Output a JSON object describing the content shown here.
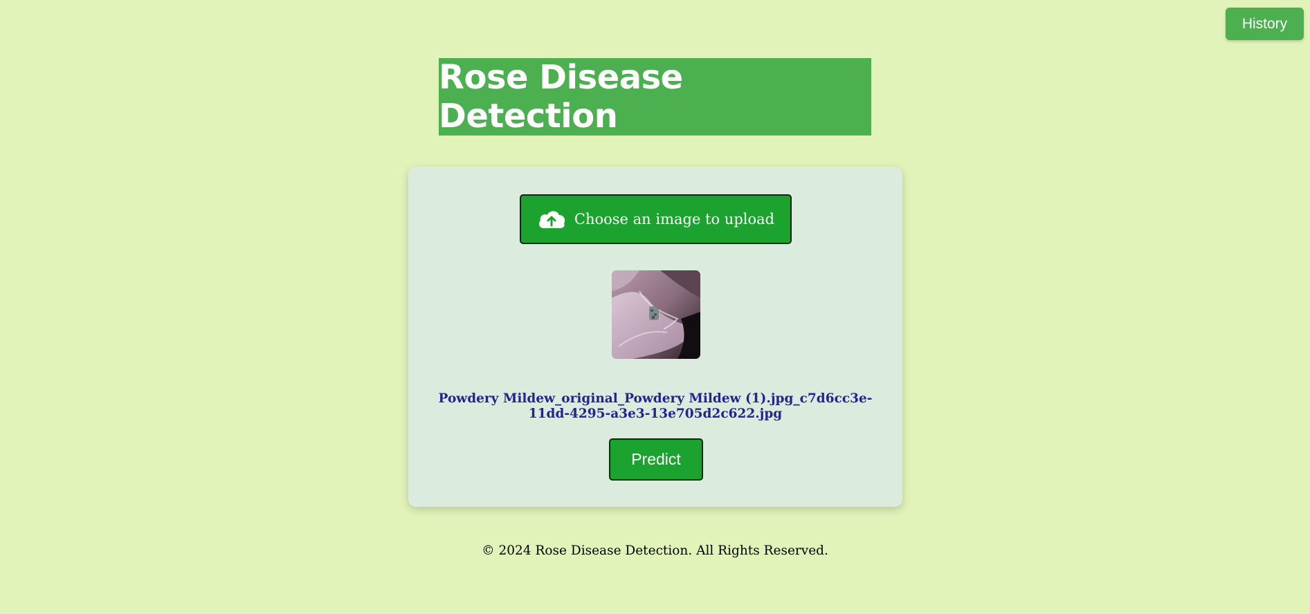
{
  "header": {
    "history_label": "History"
  },
  "banner": {
    "title": "Rose Disease Detection"
  },
  "upload": {
    "label": "Choose an image to upload",
    "icon": "cloud-upload-icon"
  },
  "preview": {
    "filename": "Powdery Mildew_original_Powdery Mildew (1).jpg_c7d6cc3e-11dd-4295-a3e3-13e705d2c622.jpg"
  },
  "actions": {
    "predict_label": "Predict"
  },
  "footer": {
    "text": "© 2024 Rose Disease Detection. All Rights Reserved."
  },
  "colors": {
    "page_background": "#e1f3b9",
    "banner_green": "#4caf50",
    "button_green": "#1ca22e",
    "card_background": "#dbebdd",
    "filename_text": "#24248f"
  }
}
